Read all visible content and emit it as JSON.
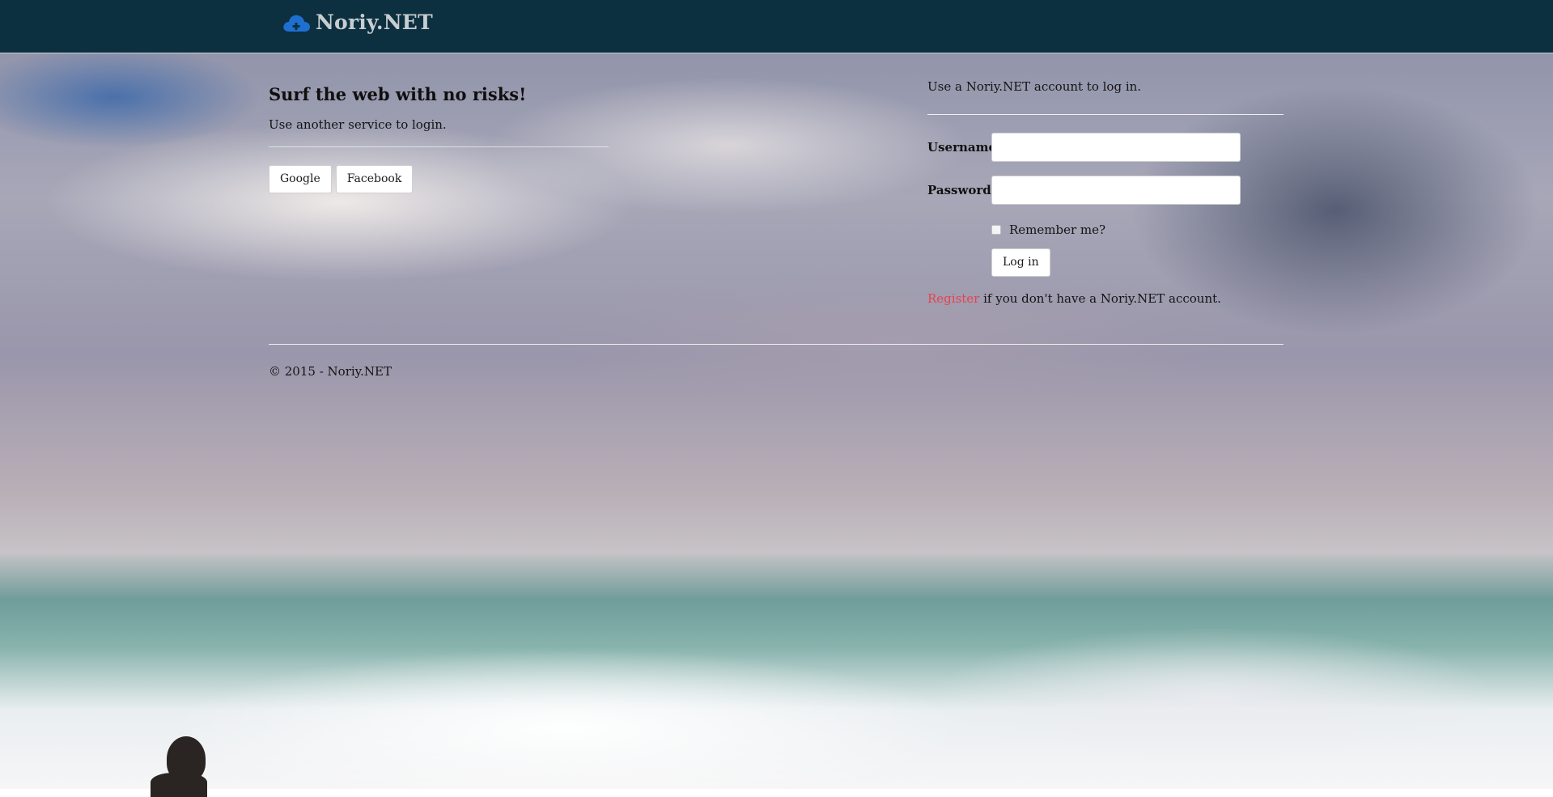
{
  "navbar": {
    "brand": "Noriy.NET",
    "brand_icon": "cloud-plus-icon",
    "brand_color": "#1f6fd1",
    "background": "#0c3040"
  },
  "external": {
    "heading": "Surf the web with no risks!",
    "subtext": "Use another service to login.",
    "buttons": [
      "Google",
      "Facebook"
    ]
  },
  "local": {
    "intro": "Use a Noriy.NET account to log in.",
    "username_label": "Username",
    "username_value": "",
    "password_label": "Password",
    "password_value": "",
    "remember_label": "Remember me?",
    "login_button": "Log in",
    "register_link": "Register",
    "register_text": " if you don't have a Noriy.NET account.",
    "register_color": "#e8434f"
  },
  "footer": {
    "copyright": "© 2015 - Noriy.NET"
  }
}
